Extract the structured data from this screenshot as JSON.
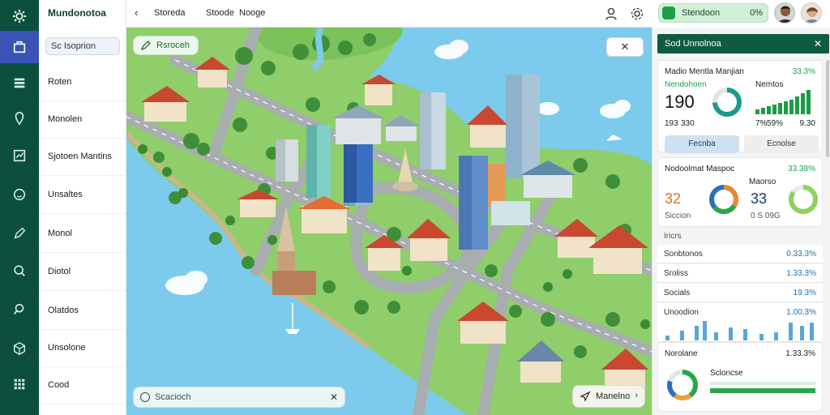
{
  "app": {
    "title": "Mundonotoa"
  },
  "sidebar": {
    "search_placeholder": "Sc Isoprion",
    "items": [
      {
        "label": "Roten",
        "icon": "layers-icon"
      },
      {
        "label": "Monolen",
        "icon": "location-pin-icon"
      },
      {
        "label": "Sjotoen Mantins",
        "icon": "chart-icon"
      },
      {
        "label": "Unsaltes",
        "icon": "face-icon"
      },
      {
        "label": "Monol",
        "icon": "pen-icon"
      },
      {
        "label": "Diotol",
        "icon": "search-icon"
      },
      {
        "label": "Olatdos",
        "icon": "search-icon"
      },
      {
        "label": "Unsolone",
        "icon": "cube-icon"
      },
      {
        "label": "Cood",
        "icon": "grid-icon"
      }
    ]
  },
  "topbar": {
    "back_icon": "back-arrow-icon",
    "crumb1": "Storeda",
    "crumb2": "Stoode",
    "crumb3": "Nooge",
    "status_label": "Stendoon",
    "status_value": "0%"
  },
  "map": {
    "chip_label": "Rsroceh",
    "close_icon": "close-icon",
    "search_placeholder": "Scacioch",
    "button_label": "Manelno"
  },
  "panel": {
    "title": "Sod Unnolnoa",
    "card1": {
      "title": "Madio Mentla Manjian",
      "pct": "33.3%",
      "sub1": "Nendohoen",
      "sub2": "Nemtos",
      "big": "190",
      "left_a": "193",
      "left_b": "330",
      "right_a": "7%",
      "right_b": "59%",
      "right_c": "9.30",
      "btn_primary": "Fecnba",
      "btn_secondary": "Ecnolse"
    },
    "card2": {
      "title": "Nodoolmat Maspoc",
      "pct": "33.38%",
      "sub": "Maorso",
      "big_left": "32",
      "big_right": "33",
      "foot_left": "Siccion",
      "foot_right": "0 S 09G"
    },
    "section_label": "Iricrs",
    "rows": [
      {
        "label": "Sonbtonos",
        "value": "0.33.3%"
      },
      {
        "label": "Sroliss",
        "value": "1.33.3%"
      },
      {
        "label": "Socials",
        "value": "19.3%"
      },
      {
        "label": "Unoodion",
        "value": "1.00.3%"
      }
    ],
    "footer": {
      "label": "Norolane",
      "value": "1.33.3%",
      "sub": "Scloncse"
    }
  }
}
